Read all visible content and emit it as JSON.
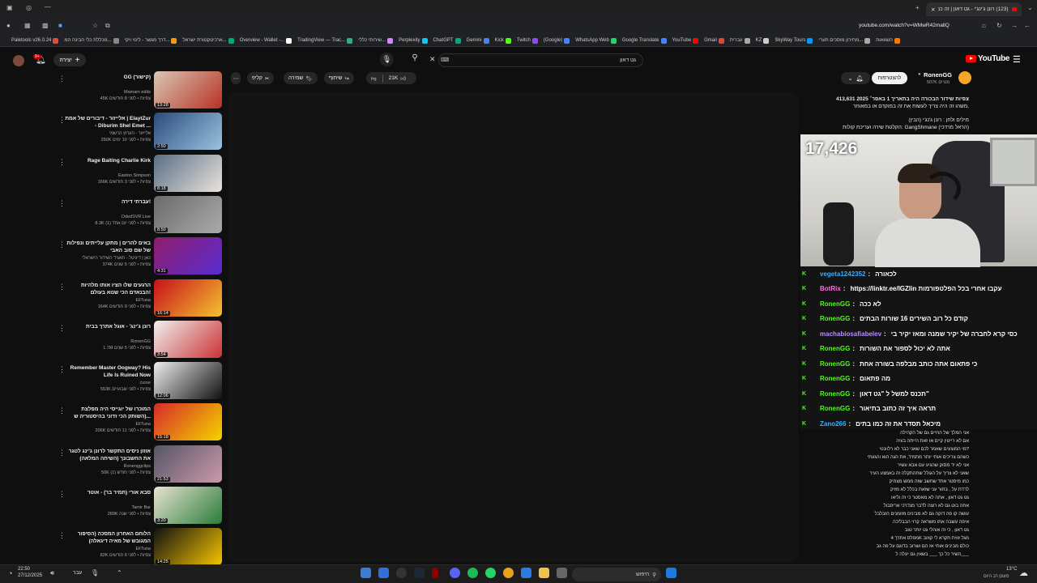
{
  "browser": {
    "tab_title": "(123) רונן ג'ינג'י - גט דאון | זה כמ...",
    "url": "youtube.com/watch?v=WMwR42mallQ",
    "bookmarks": [
      "Paletools v26.0.24",
      "מכללת כלי הבינה המ...",
      "דרך מגשר - לינוי ויקי...",
      "ארכיטקטורת ישראל...",
      "Overview - Wallet -...",
      "TradingView — Trac...",
      "שירותי כללי...",
      "Perplexity",
      "ChatGPT",
      "Gemini",
      "Kick",
      "Twitch",
      "(Google)",
      "WhatsApp Web",
      "Google Translate",
      "YouTube",
      "Gmail",
      "עברית",
      "KZ",
      "SkyWay Tours",
      "מחירון מוסכים תערי...",
      "השוואות"
    ]
  },
  "youtube": {
    "logo": "YouTube",
    "search_value": "גט דאון",
    "create_label": "יצירה",
    "notif_count": "9+"
  },
  "channel": {
    "name": "RonenGG",
    "subs": "507K מנויים",
    "subscribe": "להצטרפות"
  },
  "actions": {
    "likes": "21K",
    "share": "שיתוף",
    "save": "שמירה",
    "clip": "קליפ"
  },
  "description": {
    "stats": "413,631 צפיות  שידור הבכורה היה בתאריך 1 באפר׳ 2025",
    "line1": "משהו זה היה צריך לעשות את זה במוקדם או במאוחר.",
    "line2": "מילים ולחן : רונן ג'נג'י (הבין)",
    "line3": "הקלטת שירה ועריכת קולות: GangShmane (הראל מרדכי)"
  },
  "stream": {
    "viewers": "17,426",
    "chat": [
      {
        "user": "vegeta1242352",
        "msg": "לכאורה",
        "color": "#38b0ff"
      },
      {
        "user": "BotRix",
        "msg": "עקבו אחרי בכל הפלטפורמות https://linktr.ee/IGZlin",
        "color": "#ff6ee4"
      },
      {
        "user": "RonenGG",
        "msg": "לא ככה",
        "color": "#53fc18"
      },
      {
        "user": "RonenGG",
        "msg": "קודם כל רוב השירים 16 שורות הבתים",
        "color": "#53fc18"
      },
      {
        "user": "machabiosafiabelev",
        "msg": "כסי קרא לחברה של יקיר שמנה ומאז יקיר בי",
        "color": "#b48cff"
      },
      {
        "user": "RonenGG",
        "msg": "אתה לא יכול לספור את השורות",
        "color": "#53fc18"
      },
      {
        "user": "RonenGG",
        "msg": "כי פתאום אתה כותב מבלפה בשורה אחת",
        "color": "#53fc18"
      },
      {
        "user": "RonenGG",
        "msg": "מה פתאום",
        "color": "#53fc18"
      },
      {
        "user": "RonenGG",
        "msg": "\"תכנס למשל ל \"גט דאון",
        "color": "#53fc18"
      },
      {
        "user": "RonenGG",
        "msg": "תראה איך זה כתוב בתיאור",
        "color": "#53fc18"
      },
      {
        "user": "Zano266",
        "msg": "מיכאל תסדר את זה כמו בתים",
        "color": "#38b0ff"
      }
    ]
  },
  "lyrics": [
    "אני המלך של החיים גם של הקהילה",
    "אם לא רייטין קיים אז זאת הייתה בעיה",
    "מי המוצעים שאמר לכם שאני כבר לא רלוונטי?",
    "כשהם צריכים אותי יותר מתמיד, את הגה הוא והגעתי",
    "אני לא יד מסוק שהגיע עם אבא עשיר",
    "שאני לא צריך על הגולל שתהתקלה זה באמצע העיר",
    "כמו מיסטר אחד שחשב שזה ממש מצחיק",
    "לרדת על , בחור עני שזאת בכלל לא מזיק",
    "גט גט דאון , אתה לא מאסטר כי זה וליאו",
    "אתה בוט גם לא רוצה לדבר מנדרכי אריסבול",
    "עושה קו פה דוקה גם לא מבינים מזומנים הזבלבל",
    "איפה עשבה אתו משראה קרוי הבבליכה",
    "גט דאון , כי זה אוהלי גט יותר טוב",
    "מפלס אתרך 4K מגל זווית תקרא לי קוזוב",
    "כולם מבינים אותי אז הם ושרוב בדוגם על פה גב",
    "השיר כל כך ___ בשאין גם יעלה ל___"
  ],
  "related": [
    {
      "title": "GG (קישור)",
      "channel": "Mamam edits",
      "meta": "45K צפיות • לפני 8 חודשים",
      "dur": "13:28"
    },
    {
      "title": "אלייזור - דיבורים של אמת | ElaytZur - Diburim Shel Emet ...",
      "channel": "אלייזור - הערוץ הרשמי",
      "meta": "250K צפיות • לפני 10 ימים",
      "dur": "2:50"
    },
    {
      "title": "Rage Baiting Charlie Kirk",
      "channel": "Easton Simpson",
      "meta": "166K צפיות • לפני 3 חודשים",
      "dur": "8:18"
    },
    {
      "title": "עברתי דירה!",
      "channel": "OdedSVR Live",
      "meta": "8.3K צפיות • לפני יום אחד (1)",
      "dur": "8:50"
    },
    {
      "title": "באים להרים | מתקן עלייתים ונפילות של שם סוב האבי",
      "channel": "כאן | דיגיטל - תאגיד השידור הישראלי",
      "meta": "374K צפיות • לפני 5 שנים",
      "dur": "4:31"
    },
    {
      "title": "הרגעים שלו הציו אותו מלהיות הבנאדם הכי שנוא בעולם!",
      "channel": "EliTuna",
      "meta": "164K צפיות • לפני 9 חודשים",
      "dur": "16:14"
    },
    {
      "title": "רונן ג'ינג' - אוגל אתרך בבית",
      "channel": "RonenGG",
      "meta": "1.7M צפיות • לפני 5 שנים",
      "dur": "3:54"
    },
    {
      "title": "Remember Master Oogway? His Life Is Ruined Now",
      "channel": "curse",
      "meta": "553K צפיות • לפני שבועיים",
      "dur": "12:06"
    },
    {
      "title": "המוכרו של יוגייסי היה מפלצת (השותק הכי זדוני בהיסטוריה ש...",
      "channel": "EliTuna",
      "meta": "206K צפיות • לפני 11 חודשים",
      "dur": "15:18"
    },
    {
      "title": "אוזון ניסים התקשר לרונן ג'ינג לטגר את החשבונך (השיחה המלאה)",
      "channel": "Ronenggclips",
      "meta": "50K צפיות • לפני חודש (1)",
      "dur": "21:53"
    },
    {
      "title": "סבא אורי (תמיר בר) - אוטר",
      "channel": "Tamir Bar",
      "meta": "289K צפיות • לפני שנה",
      "dur": "3:20"
    },
    {
      "title": "הלוחם האחרון המסכה (הסיפור המגובש של מאיה דיגאלה)",
      "channel": "EliTuna",
      "meta": "82K צפיות • לפני 6 חודשים",
      "dur": "14:25"
    }
  ],
  "taskbar": {
    "time": "22:50",
    "date": "27/12/2025",
    "lang": "עבר",
    "search": "חיפוש",
    "weather": "13°C",
    "weather_desc": "מעונן רב היום"
  }
}
